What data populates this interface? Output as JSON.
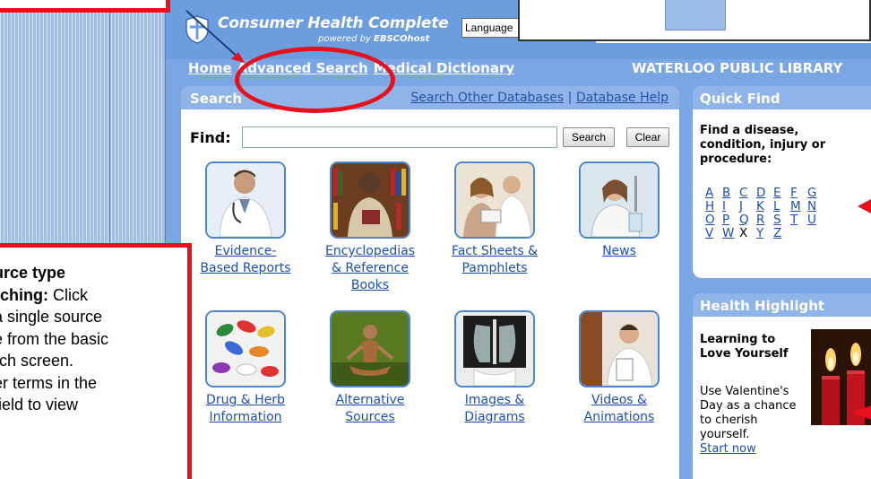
{
  "app": {
    "brand": "Consumer Health Complete",
    "powered_by_prefix": "powered by ",
    "powered_by_name": "EBSCOhost",
    "language_placeholder": "Language"
  },
  "nav": {
    "items": [
      {
        "label": "Home"
      },
      {
        "label": "Advanced Search"
      },
      {
        "label": "Medical Dictionary"
      }
    ],
    "library": "WATERLOO PUBLIC LIBRARY"
  },
  "search": {
    "title": "Search",
    "other_db_link": "Search Other Databases",
    "separator": "|",
    "help_link": "Database Help",
    "find_label": "Find:",
    "find_value": "",
    "search_button": "Search",
    "clear_button": "Clear",
    "source_types": [
      {
        "line1": "Evidence-",
        "line2": "Based Reports",
        "icon": "doctor-with-stethoscope"
      },
      {
        "line1": "Encyclopedias",
        "line2": "& Reference",
        "line3": "Books",
        "icon": "man-with-bookshelf"
      },
      {
        "line1": "Fact Sheets &",
        "line2": "Pamphlets",
        "icon": "doctor-and-patient"
      },
      {
        "line1": "News",
        "icon": "scientist-with-pipette"
      },
      {
        "line1": "Drug & Herb",
        "line2": "Information",
        "icon": "pills"
      },
      {
        "line1": "Alternative",
        "line2": "Sources",
        "icon": "meditating-woman"
      },
      {
        "line1": "Images &",
        "line2": "Diagrams",
        "icon": "chest-x-ray"
      },
      {
        "line1": "Videos &",
        "line2": "Animations",
        "icon": "doctor-with-tablet"
      }
    ]
  },
  "quick_find": {
    "title": "Quick Find",
    "prompt": "Find a disease, condition, injury or procedure:",
    "letters": [
      [
        "A",
        "B",
        "C",
        "D",
        "E",
        "F",
        "G"
      ],
      [
        "H",
        "I",
        "J",
        "K",
        "L",
        "M",
        "N"
      ],
      [
        "O",
        "P",
        "Q",
        "R",
        "S",
        "T",
        "U"
      ],
      [
        "V",
        "W",
        "X",
        "Y",
        "Z"
      ]
    ],
    "non_linked_letters": [
      "X"
    ]
  },
  "highlight": {
    "title": "Health Highlight",
    "headline": "Learning to Love Yourself",
    "body": "Use Valentine's Day as a chance to cherish yourself.",
    "link": "Start now",
    "image_icon": "candles"
  },
  "callout": {
    "heading_line1": "urce type",
    "heading_line2": "rching:",
    "text_line2_rest": " Click",
    "line3": "a single source",
    "line4": "e from the basic",
    "line5": "rch screen.",
    "line6": "er terms in the",
    "line7": " field to view"
  },
  "colors": {
    "annotation_red": "#e8101a",
    "app_blue": "#7aa7e3",
    "panel_header_blue": "#8fb4e8",
    "link_blue": "#1c4fb4"
  }
}
